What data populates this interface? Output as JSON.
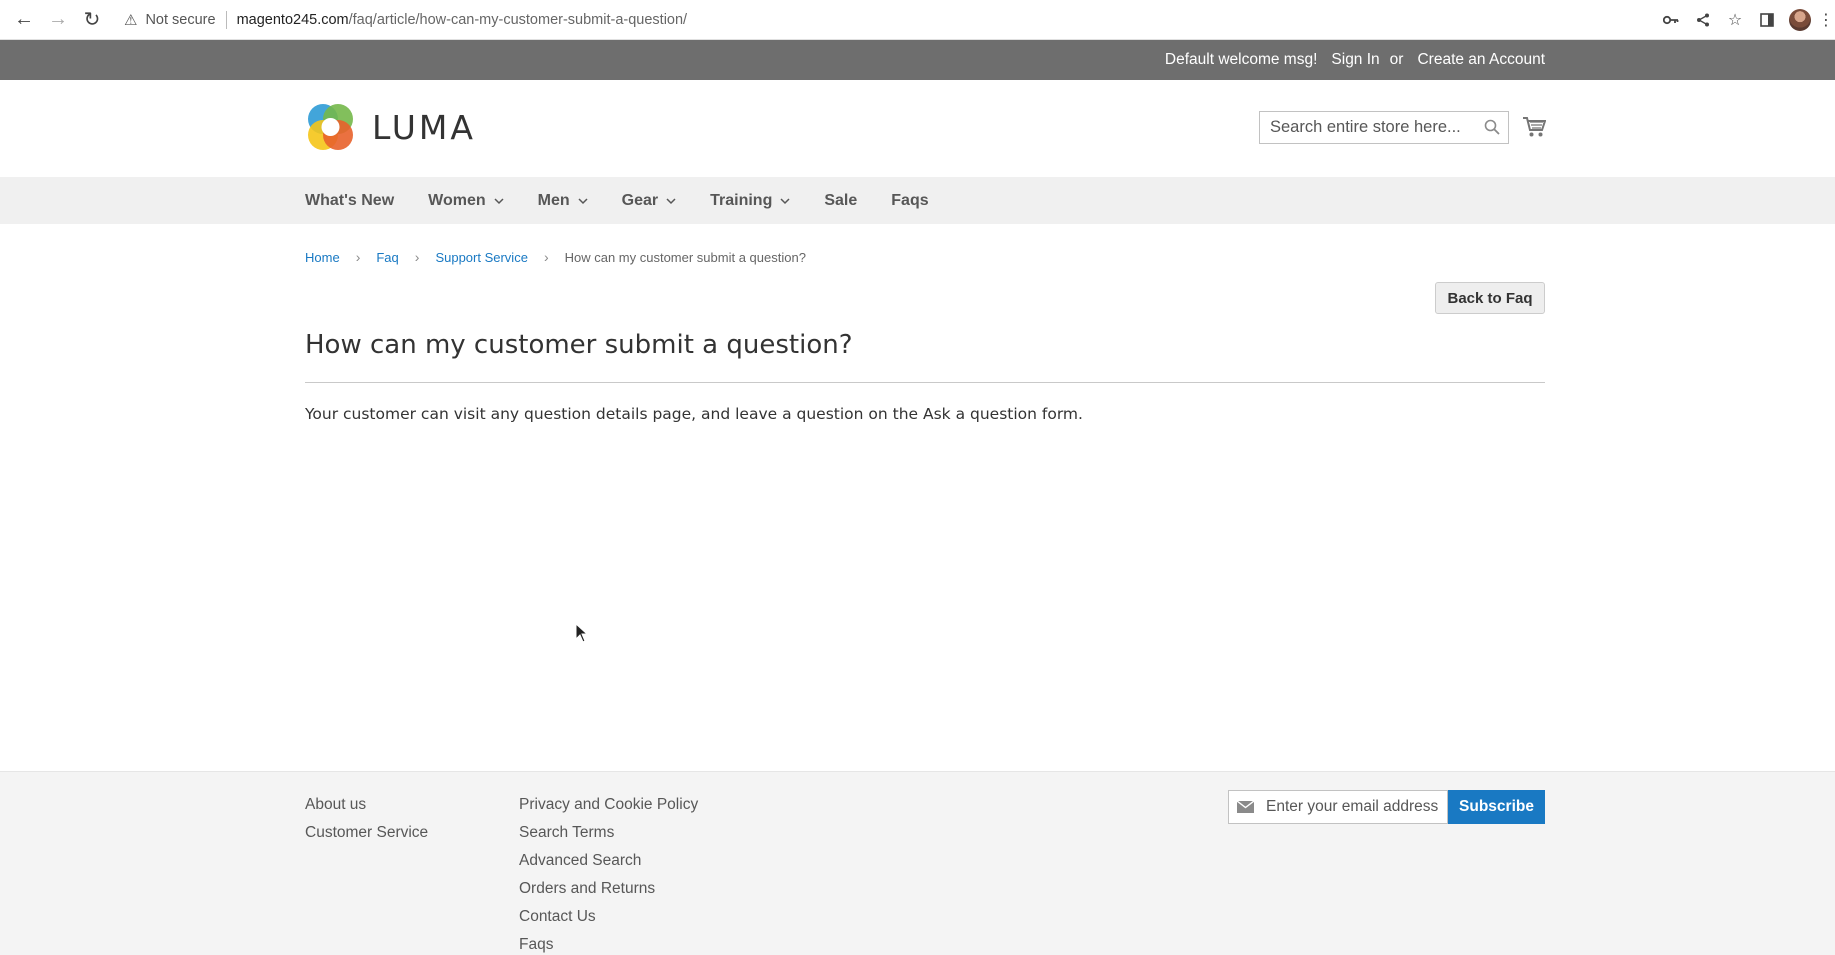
{
  "browser": {
    "security_label": "Not secure",
    "url_domain": "magento245.com",
    "url_path": "/faq/article/how-can-my-customer-submit-a-question/"
  },
  "panel": {
    "welcome": "Default welcome msg!",
    "sign_in": "Sign In",
    "or": "or",
    "create_account": "Create an Account"
  },
  "header": {
    "logo_text": "LUMA",
    "search_placeholder": "Search entire store here..."
  },
  "nav": {
    "items": [
      {
        "label": "What's New",
        "has_submenu": false
      },
      {
        "label": "Women",
        "has_submenu": true
      },
      {
        "label": "Men",
        "has_submenu": true
      },
      {
        "label": "Gear",
        "has_submenu": true
      },
      {
        "label": "Training",
        "has_submenu": true
      },
      {
        "label": "Sale",
        "has_submenu": false
      },
      {
        "label": "Faqs",
        "has_submenu": false
      }
    ]
  },
  "breadcrumbs": {
    "home": "Home",
    "faq": "Faq",
    "category": "Support Service",
    "current": "How can my customer submit a question?"
  },
  "article": {
    "back_button": "Back to Faq",
    "title": "How can my customer submit a question?",
    "body": "Your customer can visit any question details page, and leave a question on the Ask a question form."
  },
  "footer": {
    "col1": [
      "About us",
      "Customer Service"
    ],
    "col2": [
      "Privacy and Cookie Policy",
      "Search Terms",
      "Advanced Search",
      "Orders and Returns",
      "Contact Us",
      "Faqs"
    ],
    "newsletter_placeholder": "Enter your email address",
    "subscribe_label": "Subscribe"
  },
  "colors": {
    "link": "#1979c3",
    "panel_bg": "#6e6e6e",
    "nav_bg": "#f0f0f0",
    "subscribe_bg": "#1979c3"
  }
}
